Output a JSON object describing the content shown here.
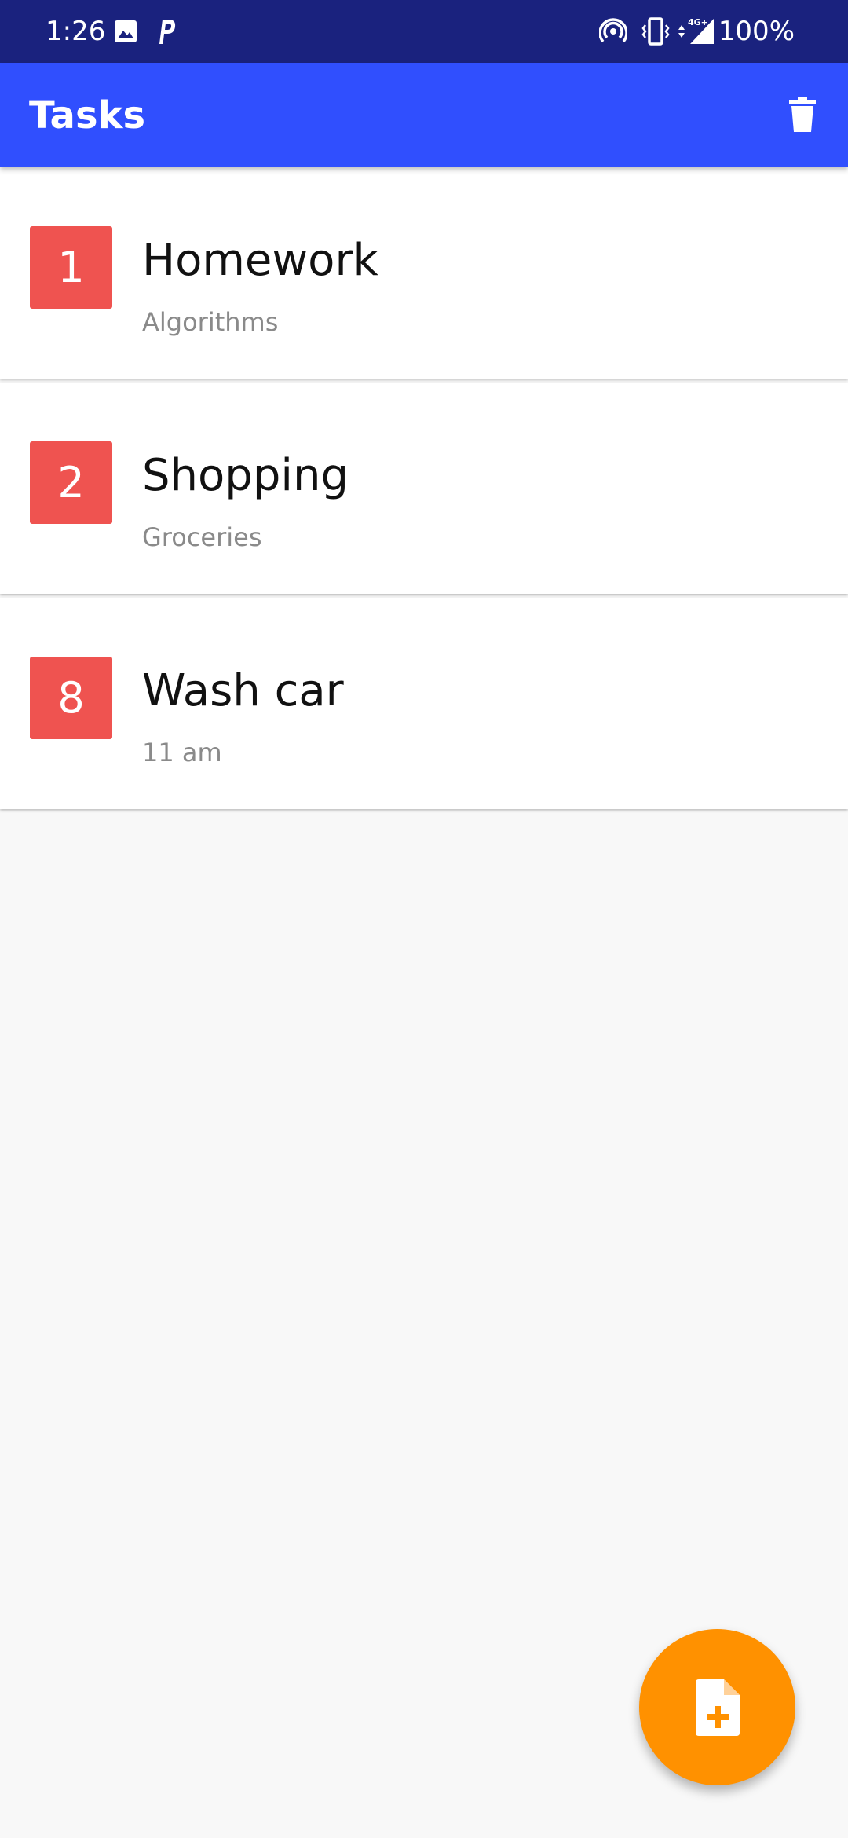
{
  "status_bar": {
    "time": "1:26",
    "battery": "100%",
    "icons": [
      "image-icon",
      "p-icon",
      "hotspot-icon",
      "vibrate-icon",
      "network-4g-icon",
      "signal-icon"
    ]
  },
  "app_bar": {
    "title": "Tasks",
    "action_icon": "delete-icon"
  },
  "tasks": [
    {
      "priority": "1",
      "title": "Homework",
      "subtitle": "Algorithms"
    },
    {
      "priority": "2",
      "title": "Shopping",
      "subtitle": "Groceries"
    },
    {
      "priority": "8",
      "title": "Wash car",
      "subtitle": "11 am"
    }
  ],
  "fab": {
    "icon": "add-note-icon"
  },
  "colors": {
    "status_bar": "#1a227e",
    "app_bar": "#304ffe",
    "priority_badge": "#ef5350",
    "fab": "#ff9100",
    "background": "#f8f8f8"
  }
}
